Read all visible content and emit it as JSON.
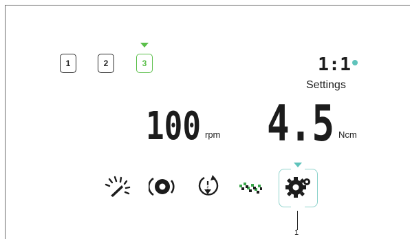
{
  "programs": {
    "items": [
      {
        "label": "1"
      },
      {
        "label": "2"
      },
      {
        "label": "3"
      }
    ],
    "selected": "3"
  },
  "ratio": {
    "value": "1:1",
    "indicator_color": "#5fc3bb"
  },
  "settings_label": "Settings",
  "speed": {
    "value": "100",
    "unit": "rpm"
  },
  "torque": {
    "value": "4.5",
    "unit": "Ncm"
  },
  "modes": [
    {
      "name": "speed-gauge-icon"
    },
    {
      "name": "rotation-icon"
    },
    {
      "name": "auto-reverse-icon"
    },
    {
      "name": "finish-flag-icon"
    },
    {
      "name": "settings-gear-icon",
      "selected": true
    }
  ],
  "callout": {
    "number": "1"
  },
  "colors": {
    "accent_green": "#5bbf4a",
    "accent_teal": "#5fc3bb",
    "icon_green": "#3aa64a",
    "ink": "#1c1c1c"
  }
}
